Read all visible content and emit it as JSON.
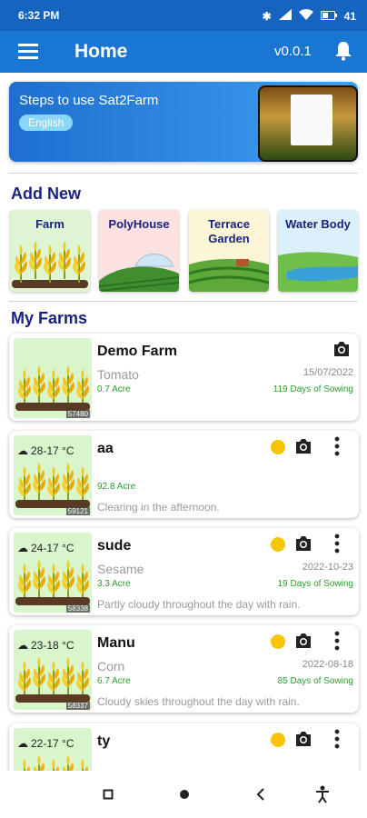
{
  "status_bar": {
    "time": "6:32 PM",
    "battery": "41"
  },
  "app_bar": {
    "title": "Home",
    "version": "v0.0.1"
  },
  "banner": {
    "title": "Steps to use Sat2Farm",
    "language": "English"
  },
  "add_new": {
    "title": "Add New",
    "items": [
      {
        "label": "Farm",
        "bg": "#dff5d2"
      },
      {
        "label": "PolyHouse",
        "bg": "#fbe1e1"
      },
      {
        "label": "Terrace Garden",
        "bg": "#fdf6d6"
      },
      {
        "label": "Water Body",
        "bg": "#dcf0fb"
      }
    ]
  },
  "my_farms": {
    "title": "My Farms",
    "farms": [
      {
        "name": "Demo Farm",
        "crop": "Tomato",
        "date": "15/07/2022",
        "area": "0.7 Acre",
        "days": "119 Days of Sowing",
        "forecast": "",
        "weather": "",
        "id": "57480"
      },
      {
        "name": "aa",
        "crop": "",
        "date": "",
        "area": "92.8 Acre",
        "days": "",
        "forecast": "Clearing in the afternoon.",
        "weather": "28-17 °C",
        "id": "59121"
      },
      {
        "name": "sude",
        "crop": "Sesame",
        "date": "2022-10-23",
        "area": "3.3 Acre",
        "days": "19 Days of Sowing",
        "forecast": "Partly cloudy throughout the day with rain.",
        "weather": "24-17 °C",
        "id": "58338"
      },
      {
        "name": "Manu",
        "crop": "Corn",
        "date": "2022-08-18",
        "area": "6.7 Acre",
        "days": "85 Days of Sowing",
        "forecast": "Cloudy skies throughout the day with rain.",
        "weather": "23-18 °C",
        "id": "58337"
      },
      {
        "name": "ty",
        "crop": "",
        "date": "",
        "area": "",
        "days": "",
        "forecast": "",
        "weather": "22-17 °C",
        "id": ""
      }
    ]
  },
  "colors": {
    "primary": "#1976d2",
    "section": "#1a237e",
    "green": "#2e9d2e",
    "crown": "#f6c400"
  }
}
